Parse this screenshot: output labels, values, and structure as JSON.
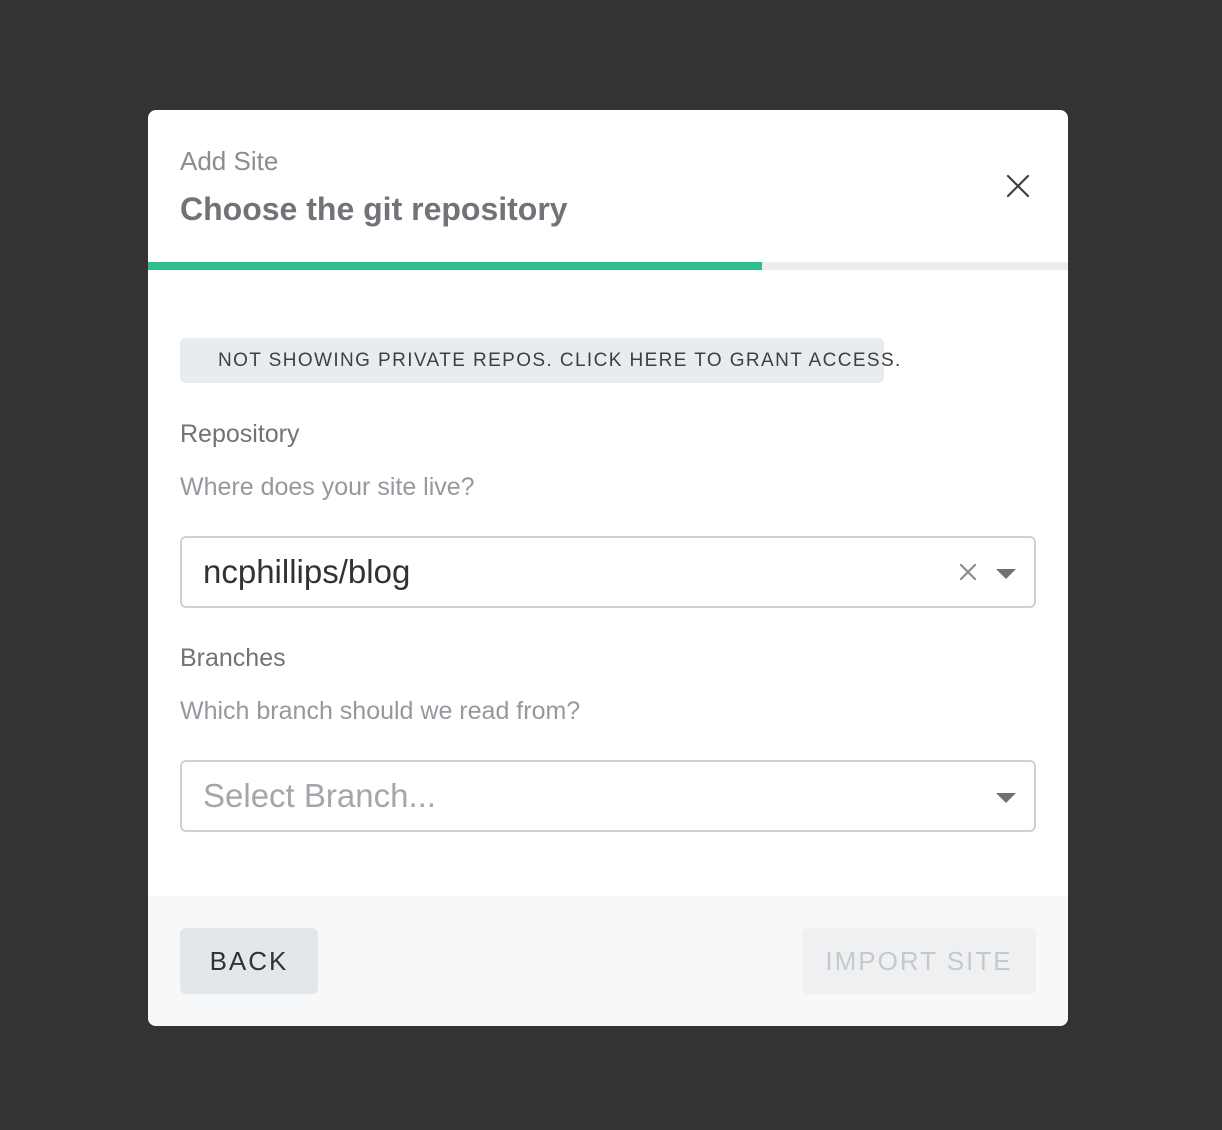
{
  "modal": {
    "eyebrow": "Add Site",
    "title": "Choose the git repository",
    "progress_percent": 66.7
  },
  "notice": {
    "icon": "lock-icon",
    "text": "NOT SHOWING PRIVATE REPOS. CLICK HERE TO GRANT ACCESS."
  },
  "repository": {
    "label": "Repository",
    "help": "Where does your site live?",
    "value": "ncphillips/blog"
  },
  "branches": {
    "label": "Branches",
    "help": "Which branch should we read from?",
    "placeholder": "Select Branch..."
  },
  "footer": {
    "back_label": "BACK",
    "import_label": "IMPORT SITE"
  },
  "colors": {
    "backdrop": "#333333",
    "accent": "#2ebd8f"
  }
}
